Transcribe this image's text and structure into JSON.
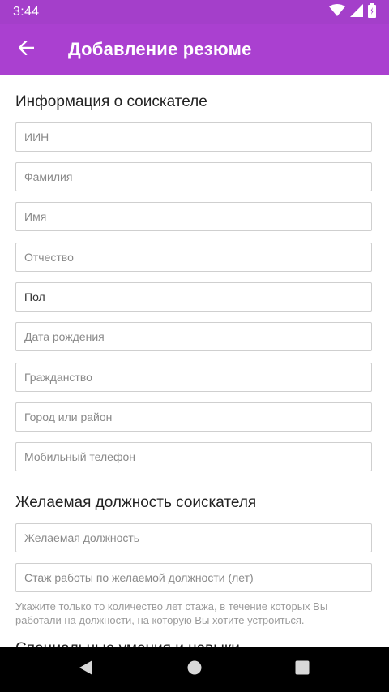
{
  "status_bar": {
    "time": "3:44",
    "icons": [
      "wifi-icon",
      "signal-icon",
      "battery-icon"
    ]
  },
  "app_bar": {
    "title": "Добавление резюме",
    "back_icon": "arrow-left-icon"
  },
  "sections": {
    "applicant_info": {
      "title": "Информация о соискателе",
      "fields": {
        "iin": "ИИН",
        "surname": "Фамилия",
        "name": "Имя",
        "patronymic": "Отчество",
        "gender": "Пол",
        "birth_date": "Дата рождения",
        "citizenship": "Гражданство",
        "city": "Город или район",
        "mobile_phone": "Мобильный телефон"
      }
    },
    "desired_position": {
      "title": "Желаемая должность соискателя",
      "fields": {
        "position": "Желаемая должность",
        "experience": "Стаж работы по желаемой должности (лет)"
      },
      "hint": "Укажите только то количество лет стажа, в течение которых Вы работали на должности, на которую Вы хотите устроиться."
    },
    "next_section_title": "Специальные умения и навыки"
  },
  "colors": {
    "status_bar": "#a43fca",
    "app_bar": "#aa40d0",
    "nav_bar": "#000000"
  }
}
